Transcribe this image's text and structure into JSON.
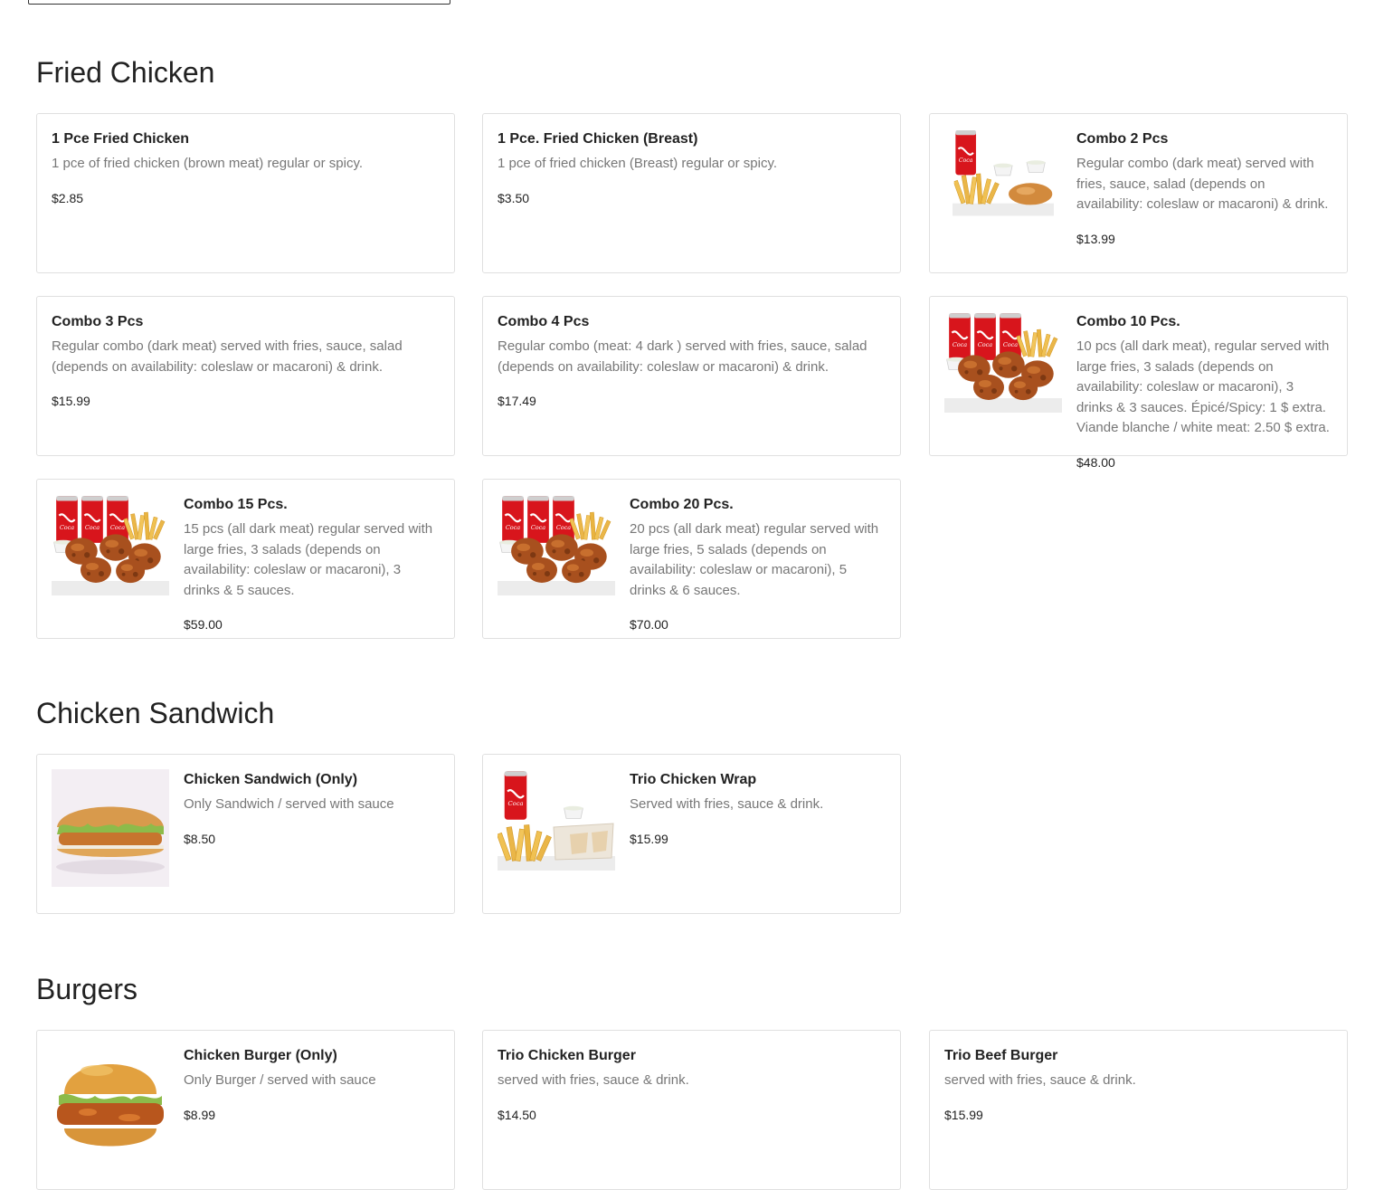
{
  "sections": {
    "fried": {
      "title": "Fried Chicken",
      "items": [
        {
          "name": "1 Pce Fried Chicken",
          "desc": "1 pce of fried chicken (brown meat) regular or spicy.",
          "price": "$2.85"
        },
        {
          "name": "1 Pce. Fried Chicken (Breast)",
          "desc": "1 pce of fried chicken (Breast) regular or spicy.",
          "price": "$3.50"
        },
        {
          "name": "Combo 2 Pcs",
          "desc": "Regular combo (dark meat) served with fries, sauce, salad (depends on availability: coleslaw or macaroni) & drink.",
          "price": "$13.99",
          "image": "combo-2-pcs-image"
        },
        {
          "name": "Combo 3 Pcs",
          "desc": "Regular combo (dark meat) served with fries, sauce, salad (depends on availability: coleslaw or macaroni) & drink.",
          "price": "$15.99"
        },
        {
          "name": "Combo 4 Pcs",
          "desc": "Regular combo (meat: 4 dark ) served with fries, sauce, salad (depends on availability: coleslaw or macaroni) & drink.",
          "price": "$17.49"
        },
        {
          "name": "Combo 10 Pcs.",
          "desc": "10 pcs (all dark meat), regular served with large fries, 3 salads (depends on availability: coleslaw or macaroni), 3 drinks & 3 sauces. Épicé/Spicy: 1 $ extra. Viande blanche / white meat: 2.50 $ extra.",
          "price": "$48.00",
          "image": "combo-10-pcs-image"
        },
        {
          "name": "Combo 15 Pcs.",
          "desc": "15 pcs (all dark meat) regular served with large fries, 3 salads (depends on availability: coleslaw or macaroni), 3 drinks & 5 sauces.",
          "price": "$59.00",
          "image": "combo-15-pcs-image"
        },
        {
          "name": "Combo 20 Pcs.",
          "desc": "20 pcs (all dark meat) regular served with large fries, 5 salads (depends on availability: coleslaw or macaroni), 5 drinks & 6 sauces.",
          "price": "$70.00",
          "image": "combo-20-pcs-image"
        }
      ]
    },
    "sandwich": {
      "title": "Chicken Sandwich",
      "items": [
        {
          "name": "Chicken Sandwich (Only)",
          "desc": "Only Sandwich / served with sauce",
          "price": "$8.50",
          "image": "chicken-sandwich-image"
        },
        {
          "name": "Trio Chicken Wrap",
          "desc": "Served with fries, sauce & drink.",
          "price": "$15.99",
          "image": "chicken-wrap-image"
        }
      ]
    },
    "burgers": {
      "title": "Burgers",
      "items": [
        {
          "name": "Chicken Burger (Only)",
          "desc": "Only Burger / served with sauce",
          "price": "$8.99",
          "image": "chicken-burger-image"
        },
        {
          "name": "Trio Chicken Burger",
          "desc": "served with fries, sauce & drink.",
          "price": "$14.50"
        },
        {
          "name": "Trio Beef Burger",
          "desc": "served with fries, sauce & drink.",
          "price": "$15.99"
        }
      ]
    }
  },
  "colors": {
    "coke_red": "#d8151c",
    "fries_gold": "#e8b844",
    "chicken_brown": "#a8501e",
    "lettuce_green": "#8dbb4a"
  }
}
